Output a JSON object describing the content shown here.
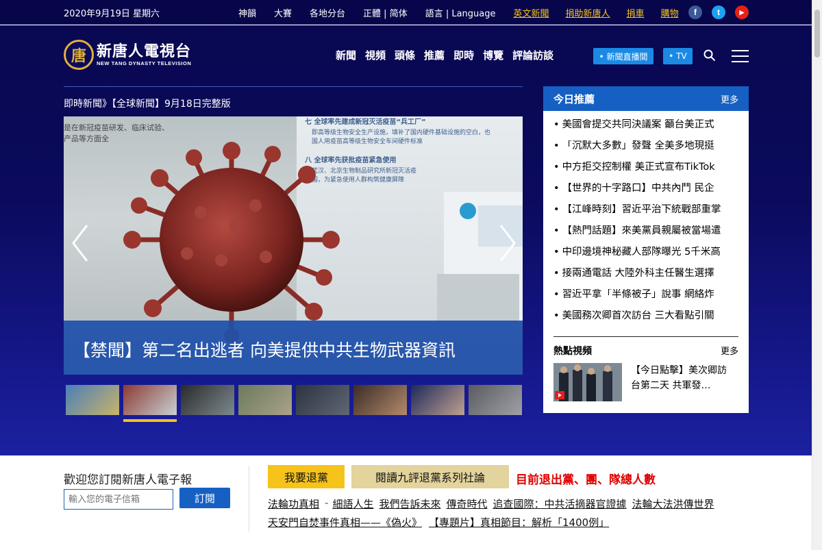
{
  "topbar": {
    "date": "2020年9月19日 星期六",
    "links": [
      "神韻",
      "大賽",
      "各地分台",
      "正體 | 简体",
      "語言 | Language"
    ],
    "highlight_links": [
      "英文新聞",
      "捐助新唐人",
      "捐車",
      "購物"
    ],
    "social": [
      {
        "icon": "facebook-icon",
        "glyph": "f",
        "color": "#3b5998"
      },
      {
        "icon": "twitter-icon",
        "glyph": "t",
        "color": "#1da1f2"
      },
      {
        "icon": "youtube-icon",
        "glyph": "▶",
        "color": "#e62117"
      }
    ]
  },
  "header": {
    "logo_seal": "唐",
    "logo_cn": "新唐人電視台",
    "logo_en": "NEW TANG DYNASTY TELEVISION",
    "nav": [
      "新聞",
      "視頻",
      "頭條",
      "推薦",
      "即時",
      "博覽",
      "評論訪談"
    ],
    "live_button": "• 新聞直播間",
    "tv_button": "• TV"
  },
  "hero": {
    "breaking": "即時新聞》【全球新聞】9月18日完整版",
    "slide_board_lines": [
      "七 全球率先建成新冠灭活疫苗“兵工厂”",
      "即高等级生物安全生产设施，填补了国内硬件基础设施的空白，也",
      "国人用疫苗高等级生物安全车间硬件标准",
      "八 全球率先获批疫苗紧急使用",
      "武汉、北京生物制品研究所新冠灭活疫",
      "国，为紧急使用人群构筑健康屏障"
    ],
    "slide_left_lines": [
      "是在新冠疫苗研发、临床试验、 ",
      "产品等方面全"
    ],
    "slide_caption": "【禁聞】第二名出逃者 向美提供中共生物武器資訊",
    "active_thumb": 1,
    "thumb_colors": [
      [
        "#4a7fb8",
        "#c9b36a"
      ],
      [
        "#8d3a34",
        "#c8d0d3"
      ],
      [
        "#2a2a2a",
        "#7c8a90"
      ],
      [
        "#6b7a5a",
        "#a9a28a"
      ],
      [
        "#2d3340",
        "#5f6874"
      ],
      [
        "#3a2c28",
        "#b38a6a"
      ],
      [
        "#1c2a5a",
        "#c0a090"
      ],
      [
        "#5a5a60",
        "#a0a0a8"
      ]
    ]
  },
  "recommend": {
    "title": "今日推薦",
    "more": "更多",
    "items": [
      "美國會提交共同決議案 籲台美正式",
      "「沉默大多數」發聲 全美多地現挺",
      "中方拒交控制權 美正式宣布TikTok",
      "【世界的十字路口】中共內鬥 民企",
      "【江峰時刻】習近平治下統戰部重掌",
      "【熱門話題】來美黨員親屬被當場遣",
      "中印邊境神秘藏人部隊曝光 5千米高",
      "接兩通電話 大陸外科主任醫生選擇",
      "習近平拿「半條被子」說事 網絡炸",
      "美國務次卿首次訪台 三大看點引關"
    ]
  },
  "hot_video": {
    "title": "熱點視頻",
    "more": "更多",
    "video_title": "【今日點擊】美次卿訪台第二天 共軍發…"
  },
  "newsletter": {
    "title": "歡迎您訂閱新唐人電子報",
    "placeholder": "輸入您的電子信箱",
    "subscribe": "訂閱"
  },
  "quit": {
    "quit_button": "我要退黨",
    "read_button": "閱讀九評退黨系列社論",
    "total_text": "目前退出黨、團、隊總人數"
  },
  "links_row1": [
    "法輪功真相",
    "細語人生",
    "我們告訴未來",
    "傳奇時代",
    "追查國際：中共活摘器官證據",
    "法輪大法洪傳世界"
  ],
  "links_row1_sep": "-",
  "links_row2": [
    "天安門自焚事件真相——《偽火》",
    "【專題片】真相節目：解析「1400例」"
  ]
}
